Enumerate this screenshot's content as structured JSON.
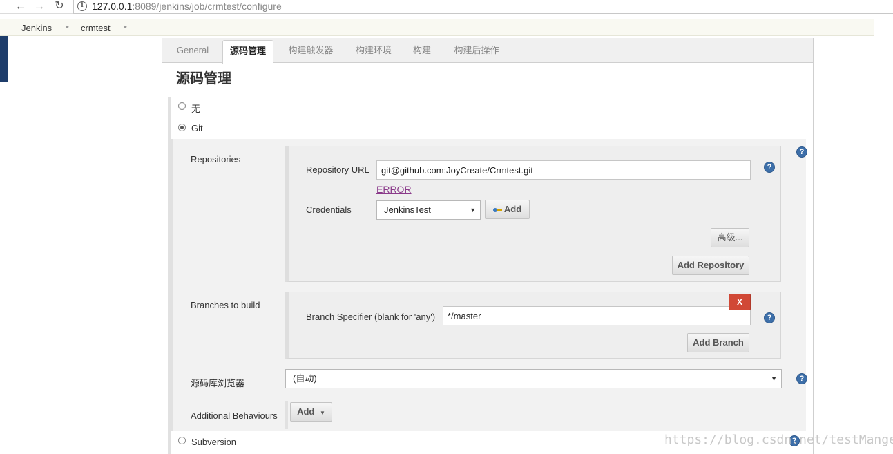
{
  "browser": {
    "url_host": "127.0.0.1",
    "url_path": ":8089/jenkins/job/crmtest/configure",
    "back_glyph": "←",
    "forward_glyph": "→",
    "reload_glyph": "↻",
    "info_glyph": "i"
  },
  "breadcrumb": {
    "items": [
      "Jenkins",
      "crmtest"
    ],
    "separator": "▸"
  },
  "tabs": [
    {
      "label": "General",
      "active": false
    },
    {
      "label": "源码管理",
      "active": true
    },
    {
      "label": "构建触发器",
      "active": false
    },
    {
      "label": "构建环境",
      "active": false
    },
    {
      "label": "构建",
      "active": false
    },
    {
      "label": "构建后操作",
      "active": false
    }
  ],
  "section_title": "源码管理",
  "scm_options": {
    "none_label": "无",
    "git_label": "Git",
    "subversion_label": "Subversion",
    "selected": "Git"
  },
  "git": {
    "repositories_label": "Repositories",
    "repository_url_label": "Repository URL",
    "repository_url_value": "git@github.com:JoyCreate/Crmtest.git",
    "error_text": "ERROR",
    "credentials_label": "Credentials",
    "credentials_selected": "JenkinsTest",
    "credentials_add_label": "Add",
    "advanced_label": "高级...",
    "add_repository_label": "Add Repository",
    "branches_label": "Branches to build",
    "delete_label": "X",
    "branch_specifier_label": "Branch Specifier (blank for 'any')",
    "branch_specifier_value": "*/master",
    "add_branch_label": "Add Branch",
    "repo_browser_label": "源码库浏览器",
    "repo_browser_selected": "(自动)",
    "additional_behaviours_label": "Additional Behaviours",
    "additional_add_label": "Add"
  },
  "help_glyph": "?",
  "dropdown_glyph": "▼",
  "watermark": "https://blog.csdn.net/testManger",
  "colors": {
    "help": "#3d6fa9",
    "delete": "#d14836",
    "error_link": "#8a3a8a"
  }
}
